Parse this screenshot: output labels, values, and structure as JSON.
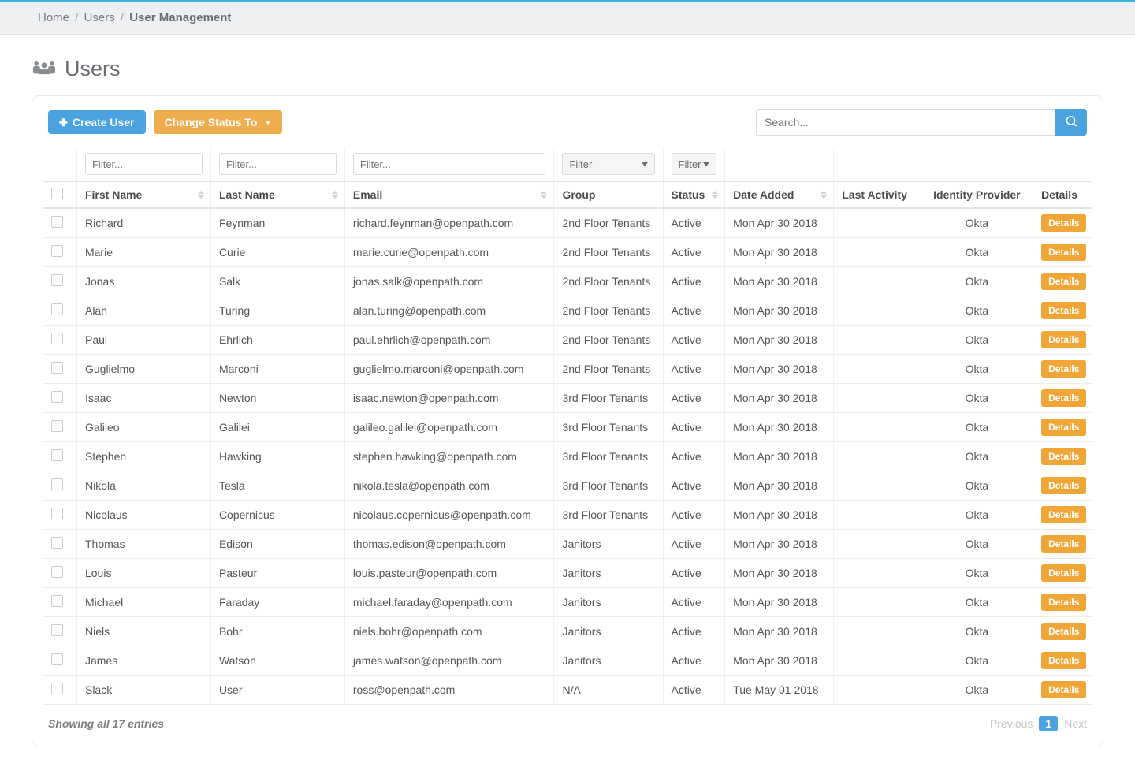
{
  "breadcrumb": {
    "home": "Home",
    "users": "Users",
    "current": "User Management"
  },
  "page_title": "Users",
  "toolbar": {
    "create_user": "Create User",
    "change_status": "Change Status To",
    "search_placeholder": "Search..."
  },
  "filters": {
    "text_placeholder": "Filter...",
    "dropdown_label": "Filter"
  },
  "columns": {
    "first_name": "First Name",
    "last_name": "Last Name",
    "email": "Email",
    "group": "Group",
    "status": "Status",
    "date_added": "Date Added",
    "last_activity": "Last Activity",
    "identity_provider": "Identity Provider",
    "details": "Details"
  },
  "details_button": "Details",
  "footer": {
    "summary": "Showing all 17 entries",
    "previous": "Previous",
    "page": "1",
    "next": "Next"
  },
  "rows": [
    {
      "first": "Richard",
      "last": "Feynman",
      "email": "richard.feynman@openpath.com",
      "group": "2nd Floor Tenants",
      "status": "Active",
      "date": "Mon Apr 30 2018",
      "activity": "",
      "idp": "Okta"
    },
    {
      "first": "Marie",
      "last": "Curie",
      "email": "marie.curie@openpath.com",
      "group": "2nd Floor Tenants",
      "status": "Active",
      "date": "Mon Apr 30 2018",
      "activity": "",
      "idp": "Okta"
    },
    {
      "first": "Jonas",
      "last": "Salk",
      "email": "jonas.salk@openpath.com",
      "group": "2nd Floor Tenants",
      "status": "Active",
      "date": "Mon Apr 30 2018",
      "activity": "",
      "idp": "Okta"
    },
    {
      "first": "Alan",
      "last": "Turing",
      "email": "alan.turing@openpath.com",
      "group": "2nd Floor Tenants",
      "status": "Active",
      "date": "Mon Apr 30 2018",
      "activity": "",
      "idp": "Okta"
    },
    {
      "first": "Paul",
      "last": "Ehrlich",
      "email": "paul.ehrlich@openpath.com",
      "group": "2nd Floor Tenants",
      "status": "Active",
      "date": "Mon Apr 30 2018",
      "activity": "",
      "idp": "Okta"
    },
    {
      "first": "Guglielmo",
      "last": "Marconi",
      "email": "guglielmo.marconi@openpath.com",
      "group": "2nd Floor Tenants",
      "status": "Active",
      "date": "Mon Apr 30 2018",
      "activity": "",
      "idp": "Okta"
    },
    {
      "first": "Isaac",
      "last": "Newton",
      "email": "isaac.newton@openpath.com",
      "group": "3rd Floor Tenants",
      "status": "Active",
      "date": "Mon Apr 30 2018",
      "activity": "",
      "idp": "Okta"
    },
    {
      "first": "Galileo",
      "last": "Galilei",
      "email": "galileo.galilei@openpath.com",
      "group": "3rd Floor Tenants",
      "status": "Active",
      "date": "Mon Apr 30 2018",
      "activity": "",
      "idp": "Okta"
    },
    {
      "first": "Stephen",
      "last": "Hawking",
      "email": "stephen.hawking@openpath.com",
      "group": "3rd Floor Tenants",
      "status": "Active",
      "date": "Mon Apr 30 2018",
      "activity": "",
      "idp": "Okta"
    },
    {
      "first": "Nikola",
      "last": "Tesla",
      "email": "nikola.tesla@openpath.com",
      "group": "3rd Floor Tenants",
      "status": "Active",
      "date": "Mon Apr 30 2018",
      "activity": "",
      "idp": "Okta"
    },
    {
      "first": "Nicolaus",
      "last": "Copernicus",
      "email": "nicolaus.copernicus@openpath.com",
      "group": "3rd Floor Tenants",
      "status": "Active",
      "date": "Mon Apr 30 2018",
      "activity": "",
      "idp": "Okta"
    },
    {
      "first": "Thomas",
      "last": "Edison",
      "email": "thomas.edison@openpath.com",
      "group": "Janitors",
      "status": "Active",
      "date": "Mon Apr 30 2018",
      "activity": "",
      "idp": "Okta"
    },
    {
      "first": "Louis",
      "last": "Pasteur",
      "email": "louis.pasteur@openpath.com",
      "group": "Janitors",
      "status": "Active",
      "date": "Mon Apr 30 2018",
      "activity": "",
      "idp": "Okta"
    },
    {
      "first": "Michael",
      "last": "Faraday",
      "email": "michael.faraday@openpath.com",
      "group": "Janitors",
      "status": "Active",
      "date": "Mon Apr 30 2018",
      "activity": "",
      "idp": "Okta"
    },
    {
      "first": "Niels",
      "last": "Bohr",
      "email": "niels.bohr@openpath.com",
      "group": "Janitors",
      "status": "Active",
      "date": "Mon Apr 30 2018",
      "activity": "",
      "idp": "Okta"
    },
    {
      "first": "James",
      "last": "Watson",
      "email": "james.watson@openpath.com",
      "group": "Janitors",
      "status": "Active",
      "date": "Mon Apr 30 2018",
      "activity": "",
      "idp": "Okta"
    },
    {
      "first": "Slack",
      "last": "User",
      "email": "ross@openpath.com",
      "group": "N/A",
      "status": "Active",
      "date": "Tue May 01 2018",
      "activity": "",
      "idp": "Okta"
    }
  ]
}
